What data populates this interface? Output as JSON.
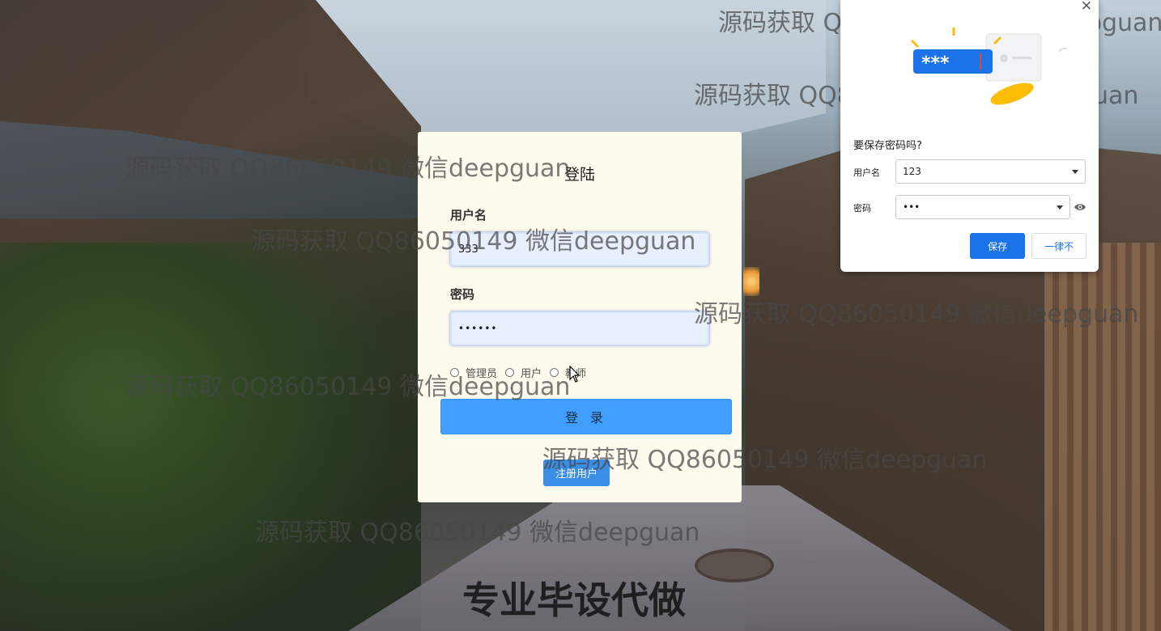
{
  "login": {
    "title": "登陆",
    "username_label": "用户名",
    "username_value": "333",
    "password_label": "密码",
    "password_value": "••••••",
    "roles": [
      "管理员",
      "用户",
      "教师"
    ],
    "login_button": "登 录",
    "register_button": "注册用户"
  },
  "save_password_popup": {
    "close": "×",
    "heading": "要保存密码吗?",
    "username_label": "用户名",
    "username_value": "123",
    "password_label": "密码",
    "password_value": "•••",
    "save_button": "保存",
    "never_button": "一律不",
    "illustration_text": "***"
  },
  "watermarks": {
    "text": "源码获取 QQ86050149 微信deepguan",
    "bottom_text": "专业毕设代做"
  },
  "colors": {
    "login_button": "#409eff",
    "register_button": "#3a8ee6",
    "card_background": "#fdfaee",
    "popup_save": "#1a73e8"
  }
}
